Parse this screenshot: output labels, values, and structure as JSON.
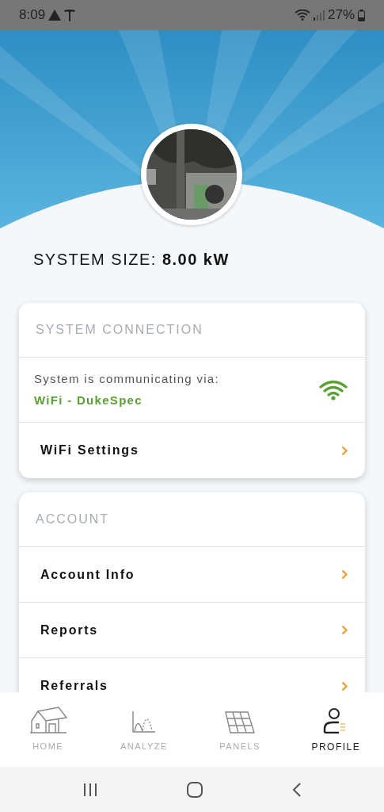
{
  "status_bar": {
    "time": "8:09",
    "battery": "27%"
  },
  "system_size": {
    "label": "SYSTEM SIZE:",
    "value": "8.00 kW"
  },
  "sections": [
    {
      "title": "SYSTEM CONNECTION",
      "rows": [
        {
          "kind": "status",
          "text": "System is communicating via:",
          "value": "WiFi - DukeSpec"
        },
        {
          "kind": "link",
          "label": "WiFi Settings"
        }
      ]
    },
    {
      "title": "ACCOUNT",
      "rows": [
        {
          "kind": "link",
          "label": "Account Info"
        },
        {
          "kind": "link",
          "label": "Reports"
        },
        {
          "kind": "link",
          "label": "Referrals"
        }
      ]
    }
  ],
  "tabs": [
    {
      "label": "HOME",
      "selected": false
    },
    {
      "label": "ANALYZE",
      "selected": false
    },
    {
      "label": "PANELS",
      "selected": false
    },
    {
      "label": "PROFILE",
      "selected": true
    }
  ]
}
